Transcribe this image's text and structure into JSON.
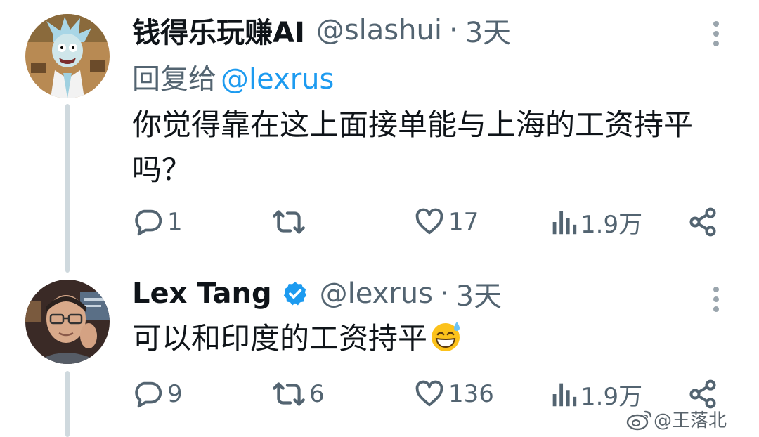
{
  "tweets": [
    {
      "author_name": "钱得乐玩赚AI",
      "handle": "@slashui",
      "separator": "·",
      "time": "3天",
      "reply_prefix": "回复给",
      "reply_mention": "@lexrus",
      "text_line1": "你觉得靠在这上面接单能与上海的工资持平",
      "text_line2": "吗？",
      "avatar_icon": "cartoon-scientist-avatar",
      "stats": {
        "replies": "1",
        "retweets": "",
        "likes": "17",
        "views": "1.9万"
      }
    },
    {
      "author_name": "Lex Tang",
      "handle": "@lexrus",
      "separator": "·",
      "time": "3天",
      "verified": true,
      "text": "可以和印度的工资持平",
      "emoji": "grinning-sweat-emoji",
      "avatar_icon": "photo-man-glasses-avatar",
      "stats": {
        "replies": "9",
        "retweets": "6",
        "likes": "136",
        "views": "1.9万"
      }
    }
  ],
  "watermark": {
    "icon": "weibo-logo",
    "text": "@王落北"
  },
  "colors": {
    "primary_text": "#0f1419",
    "secondary_text": "#536471",
    "link": "#1d9bf0",
    "verified": "#1d9bf0",
    "thread_line": "#cfd9de"
  }
}
